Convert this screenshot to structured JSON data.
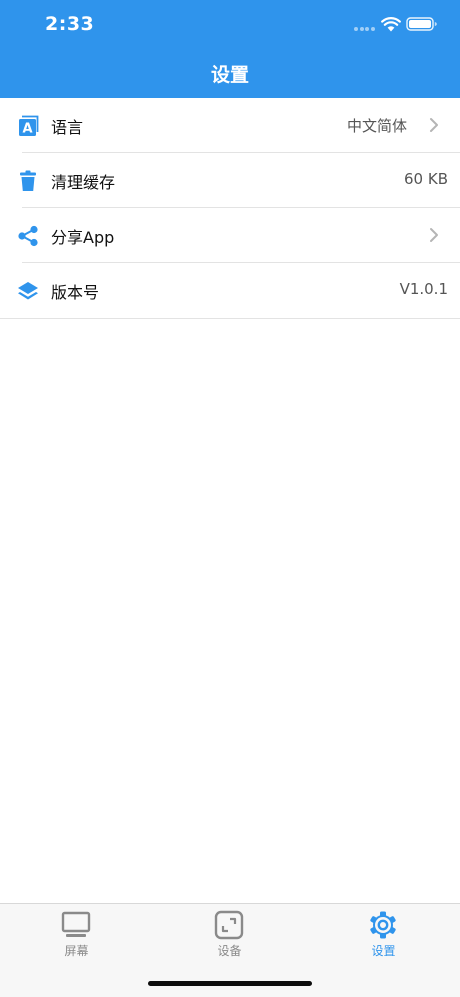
{
  "status_bar": {
    "time": "2:33"
  },
  "header": {
    "title": "设置",
    "background_color": "#2f94ec"
  },
  "settings": {
    "items": [
      {
        "icon": "language-icon",
        "label": "语言",
        "value": "中文简体",
        "has_chevron": true
      },
      {
        "icon": "trash-icon",
        "label": "清理缓存",
        "value": "60 KB",
        "has_chevron": false
      },
      {
        "icon": "share-icon",
        "label": "分享App",
        "value": "",
        "has_chevron": true
      },
      {
        "icon": "layers-icon",
        "label": "版本号",
        "value": "V1.0.1",
        "has_chevron": false
      }
    ]
  },
  "tab_bar": {
    "active_index": 2,
    "active_color": "#2f94ec",
    "tabs": [
      {
        "icon": "monitor-icon",
        "label": "屏幕"
      },
      {
        "icon": "device-frame-icon",
        "label": "设备"
      },
      {
        "icon": "gear-icon",
        "label": "设置"
      }
    ]
  }
}
